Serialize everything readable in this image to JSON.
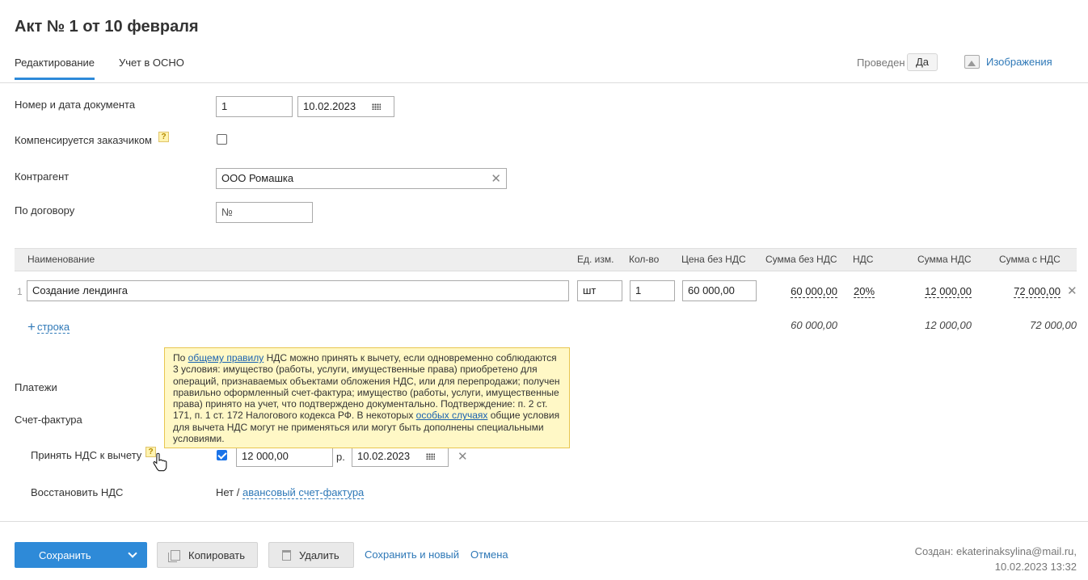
{
  "header": {
    "title": "Акт № 1 от 10 февраля",
    "tabs": [
      "Редактирование",
      "Учет в ОСНО"
    ],
    "posted_label": "Проведен",
    "posted_value": "Да",
    "images_label": "Изображения"
  },
  "form": {
    "doc_label": "Номер и дата документа",
    "doc_number": "1",
    "doc_date": "10.02.2023",
    "compensated_label": "Компенсируется заказчиком",
    "help_glyph": "?",
    "contractor_label": "Контрагент",
    "contractor_value": "ООО Ромашка",
    "contract_label": "По договору",
    "contract_placeholder": "№"
  },
  "table": {
    "headers": [
      "Наименование",
      "Ед. изм.",
      "Кол-во",
      "Цена без НДС",
      "Сумма без НДС",
      "НДС",
      "Сумма НДС",
      "Сумма с НДС"
    ],
    "rows": [
      {
        "index": "1",
        "name": "Создание лендинга",
        "unit": "шт",
        "qty": "1",
        "price": "60 000,00",
        "sum_no_vat": "60 000,00",
        "vat_rate": "20%",
        "vat_sum": "12 000,00",
        "sum_with_vat": "72 000,00"
      }
    ],
    "add_row_plus": "+",
    "add_row_label": "строка",
    "totals": {
      "sum_no_vat": "60 000,00",
      "vat_sum": "12 000,00",
      "sum_with_vat": "72 000,00"
    }
  },
  "tooltip": {
    "p1": "По ",
    "link1": "общему правилу",
    "p2": " НДС можно принять к вычету, если одновременно соблюдаются 3 условия: имущество (работы, услуги, имущественные права) приобретено для операций, признаваемых объектами обложения НДС, или для перепродажи; получен правильно оформленный счет-фактура; имущество (работы, услуги, имущественные права) принято на учет, что подтверждено документально. Подтверждение: п. 2 ст. 171, п. 1 ст. 172 Налогового кодекса РФ. В некоторых ",
    "link2": "особых случаях",
    "p3": " общие условия для вычета НДС могут не применяться или могут быть дополнены специальными условиями."
  },
  "payments": {
    "payments_label": "Платежи",
    "invoice_label": "Счет-фактура",
    "accept_vat_label": "Принять НДС к вычету",
    "accept_vat_amount": "12 000,00",
    "currency": "р.",
    "accept_vat_date": "10.02.2023",
    "restore_vat_label": "Восстановить НДС",
    "restore_vat_value": "Нет /",
    "restore_vat_link": "авансовый счет-фактура"
  },
  "footer": {
    "save_label": "Сохранить",
    "copy_label": "Копировать",
    "delete_label": "Удалить",
    "save_new_label": "Сохранить и новый",
    "cancel_label": "Отмена",
    "created_line1": "Создан: ekaterinaksylina@mail.ru,",
    "created_line2": "10.02.2023 13:32"
  },
  "colors": {
    "accent": "#2e8ad8",
    "link": "#2e78b7",
    "tooltip_bg": "#fff8c6"
  }
}
